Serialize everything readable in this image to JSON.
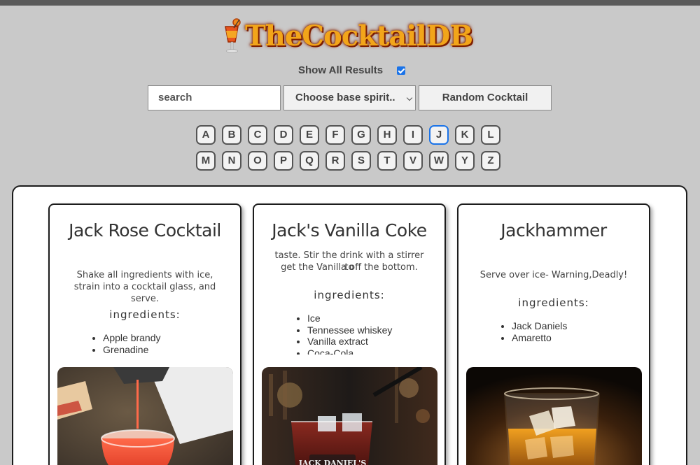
{
  "logo": {
    "text": "TheCocktailDB",
    "glass_icon": "cocktail-glass-icon",
    "text_color": "#f2a51a"
  },
  "show_all": {
    "label": "Show All Results",
    "checked": true
  },
  "search": {
    "placeholder": "search"
  },
  "base_spirit": {
    "selected": "Choose base spirit.."
  },
  "random_button": {
    "label": "Random Cocktail"
  },
  "letters_row1": [
    "A",
    "B",
    "C",
    "D",
    "E",
    "F",
    "G",
    "H",
    "I",
    "J",
    "K",
    "L"
  ],
  "letters_row2": [
    "M",
    "N",
    "O",
    "P",
    "Q",
    "R",
    "S",
    "T",
    "V",
    "W",
    "Y",
    "Z"
  ],
  "active_letter": "J",
  "cards": [
    {
      "title": "Jack Rose Cocktail",
      "instructions": "Shake all ingredients with ice, strain into a cocktail glass, and serve.",
      "ingredients_heading": "ingredients:",
      "ingredients": [
        "Apple brandy",
        "Grenadine"
      ]
    },
    {
      "title": "Jack's Vanilla Coke",
      "instructions_partial_top": "taste. Stir the drink with a stirrer to",
      "instructions": "get the Vanilla off the bottom.",
      "ingredients_heading": "ingredients:",
      "ingredients": [
        "Ice",
        "Tennessee whiskey",
        "Vanilla extract",
        "Coca-Cola"
      ]
    },
    {
      "title": "Jackhammer",
      "instructions": "Serve over ice- Warning,Deadly!",
      "ingredients_heading": "ingredients:",
      "ingredients": [
        "Jack Daniels",
        "Amaretto"
      ]
    }
  ]
}
